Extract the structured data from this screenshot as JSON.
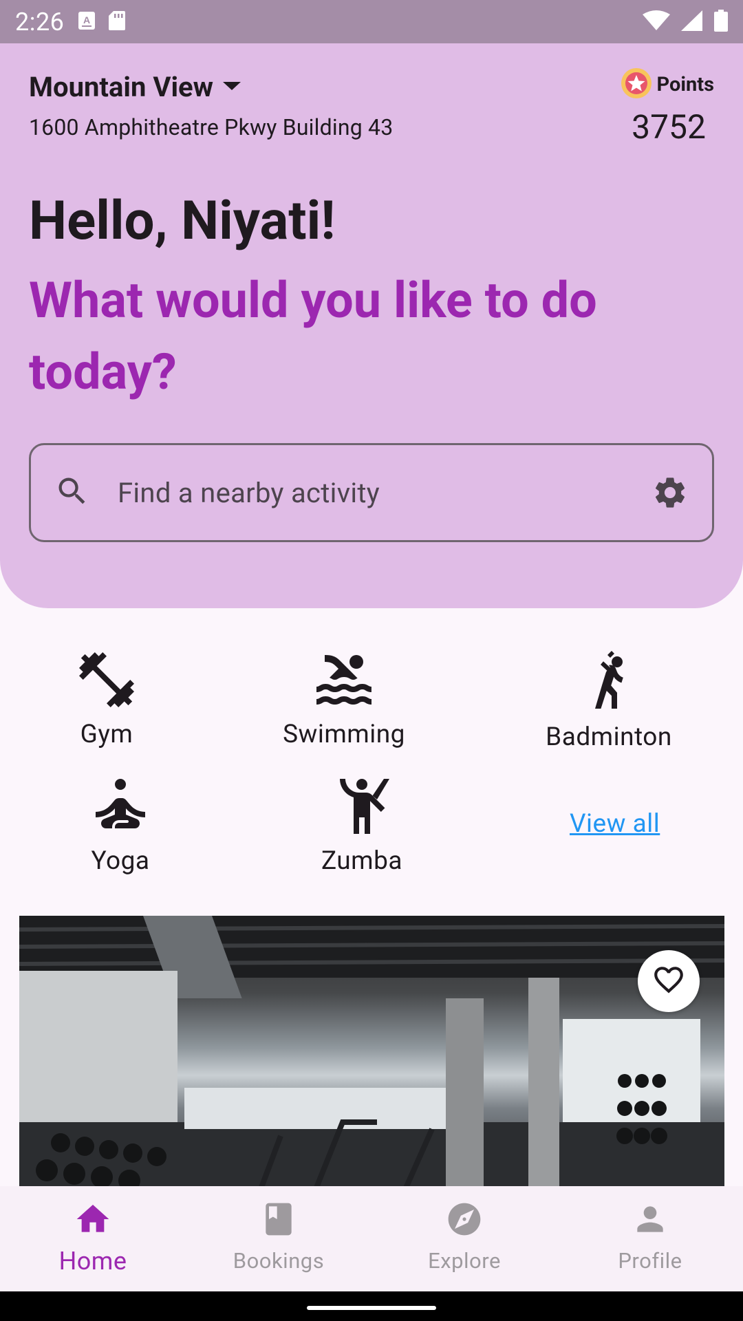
{
  "status_bar": {
    "time": "2:26",
    "left_icons": [
      "text-notification-icon",
      "sd-card-icon"
    ],
    "right_icons": [
      "wifi-icon",
      "cellular-signal-icon",
      "battery-icon"
    ]
  },
  "header": {
    "city": "Mountain View",
    "address": "1600 Amphitheatre Pkwy Building 43",
    "points_label": "Points",
    "points_value": "3752"
  },
  "greeting": "Hello, Niyati!",
  "question": "What would you like to do today?",
  "search": {
    "placeholder": "Find a nearby activity"
  },
  "categories": [
    {
      "label": "Gym",
      "icon": "dumbbell-icon"
    },
    {
      "label": "Swimming",
      "icon": "swimmer-icon"
    },
    {
      "label": "Badminton",
      "icon": "badminton-player-icon"
    },
    {
      "label": "Yoga",
      "icon": "meditation-icon"
    },
    {
      "label": "Zumba",
      "icon": "dancer-icon"
    }
  ],
  "view_all_label": "View all",
  "bottom_nav": [
    {
      "label": "Home",
      "icon": "home-icon",
      "active": true
    },
    {
      "label": "Bookings",
      "icon": "book-icon",
      "active": false
    },
    {
      "label": "Explore",
      "icon": "compass-icon",
      "active": false
    },
    {
      "label": "Profile",
      "icon": "person-icon",
      "active": false
    }
  ],
  "colors": {
    "hero_background": "#E0BCE6",
    "accent": "#9C27B0",
    "link": "#2196F3",
    "status_bar": "#A48DA7"
  }
}
